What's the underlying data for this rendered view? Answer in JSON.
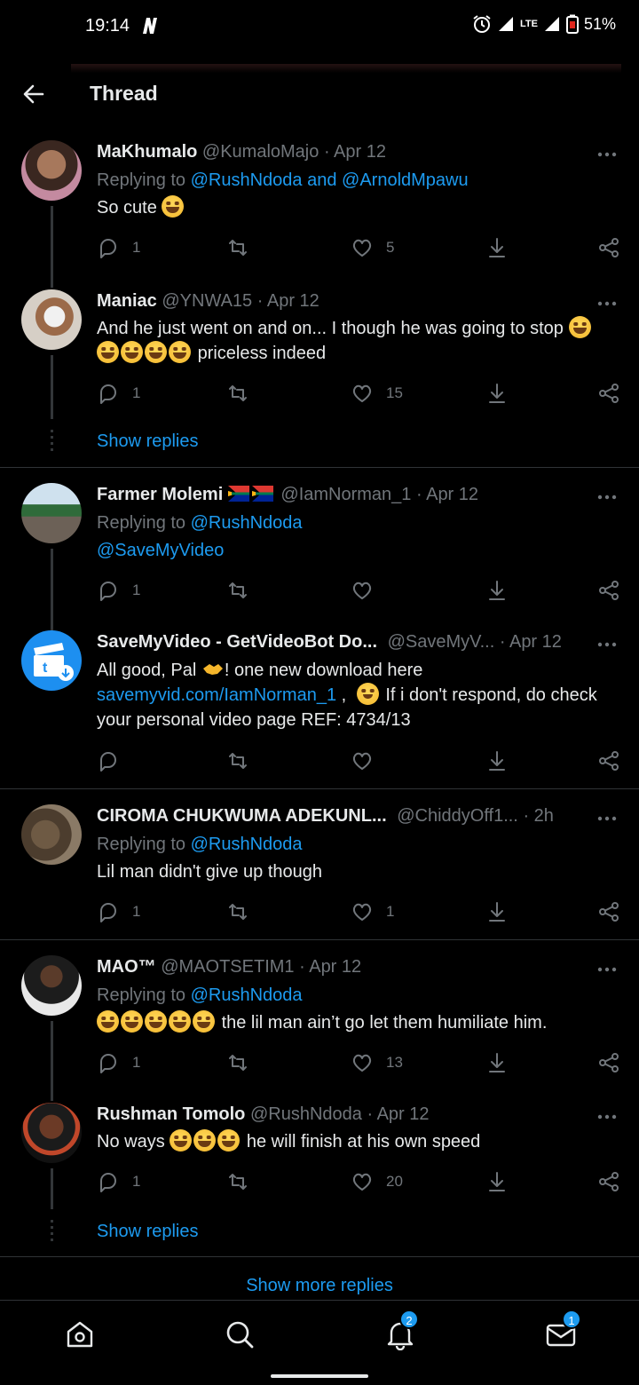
{
  "status_bar": {
    "time": "19:14",
    "battery": "51%",
    "network": "LTE"
  },
  "header": {
    "title": "Thread"
  },
  "tweets": [
    {
      "name": "MaKhumalo",
      "handle": "@KumaloMajo",
      "time": "· Apr 12",
      "replying_prefix": "Replying to",
      "replying_to": "@RushNdoda and @ArnoldMpawu",
      "text": "So cute",
      "replies": "1",
      "retweets": "",
      "likes": "5"
    },
    {
      "name": "Maniac",
      "handle": "@YNWA15",
      "time": "· Apr 12",
      "text_line1": "And he just went on and on... I though he was going to stop",
      "text_line2": "priceless indeed",
      "replies": "1",
      "retweets": "",
      "likes": "15",
      "show_replies": "Show replies"
    },
    {
      "name": "Farmer Molemi",
      "handle": "@IamNorman_1",
      "time": "· Apr 12",
      "replying_prefix": "Replying to",
      "replying_to": "@RushNdoda",
      "text": "@SaveMyVideo",
      "replies": "1",
      "retweets": "",
      "likes": ""
    },
    {
      "name": "SaveMyVideo - GetVideoBot Do...",
      "handle": "@SaveMyV...",
      "time": "· Apr 12",
      "text_line1a": "All good, Pal",
      "text_line1b": "! one new download here",
      "link": "savemyvid.com/IamNorman_1",
      "text_line2b": "If i don't respond, do check",
      "text_line3": "your personal video page REF: 4734/13",
      "replies": "",
      "retweets": "",
      "likes": ""
    },
    {
      "name": "CIROMA CHUKWUMA ADEKUNL...",
      "handle": "@ChiddyOff1...",
      "time": "· 2h",
      "replying_prefix": "Replying to",
      "replying_to": "@RushNdoda",
      "text": "Lil man didn't give up though",
      "replies": "1",
      "retweets": "",
      "likes": "1"
    },
    {
      "name": "MAO™",
      "handle": "@MAOTSETIM1",
      "time": "· Apr 12",
      "replying_prefix": "Replying to",
      "replying_to": "@RushNdoda",
      "text": "the lil man ain’t go let them humiliate him.",
      "replies": "1",
      "retweets": "",
      "likes": "13"
    },
    {
      "name": "Rushman Tomolo",
      "handle": "@RushNdoda",
      "time": "· Apr 12",
      "text_a": "No ways",
      "text_b": "he will finish at his own speed",
      "replies": "1",
      "retweets": "",
      "likes": "20",
      "show_replies": "Show replies"
    }
  ],
  "show_more_replies": "Show more replies",
  "bottom_nav": {
    "notifications_badge": "2",
    "messages_badge": "1"
  },
  "colors": {
    "accent": "#1d9bf0",
    "background": "#000000",
    "secondary_text": "#71767b"
  }
}
